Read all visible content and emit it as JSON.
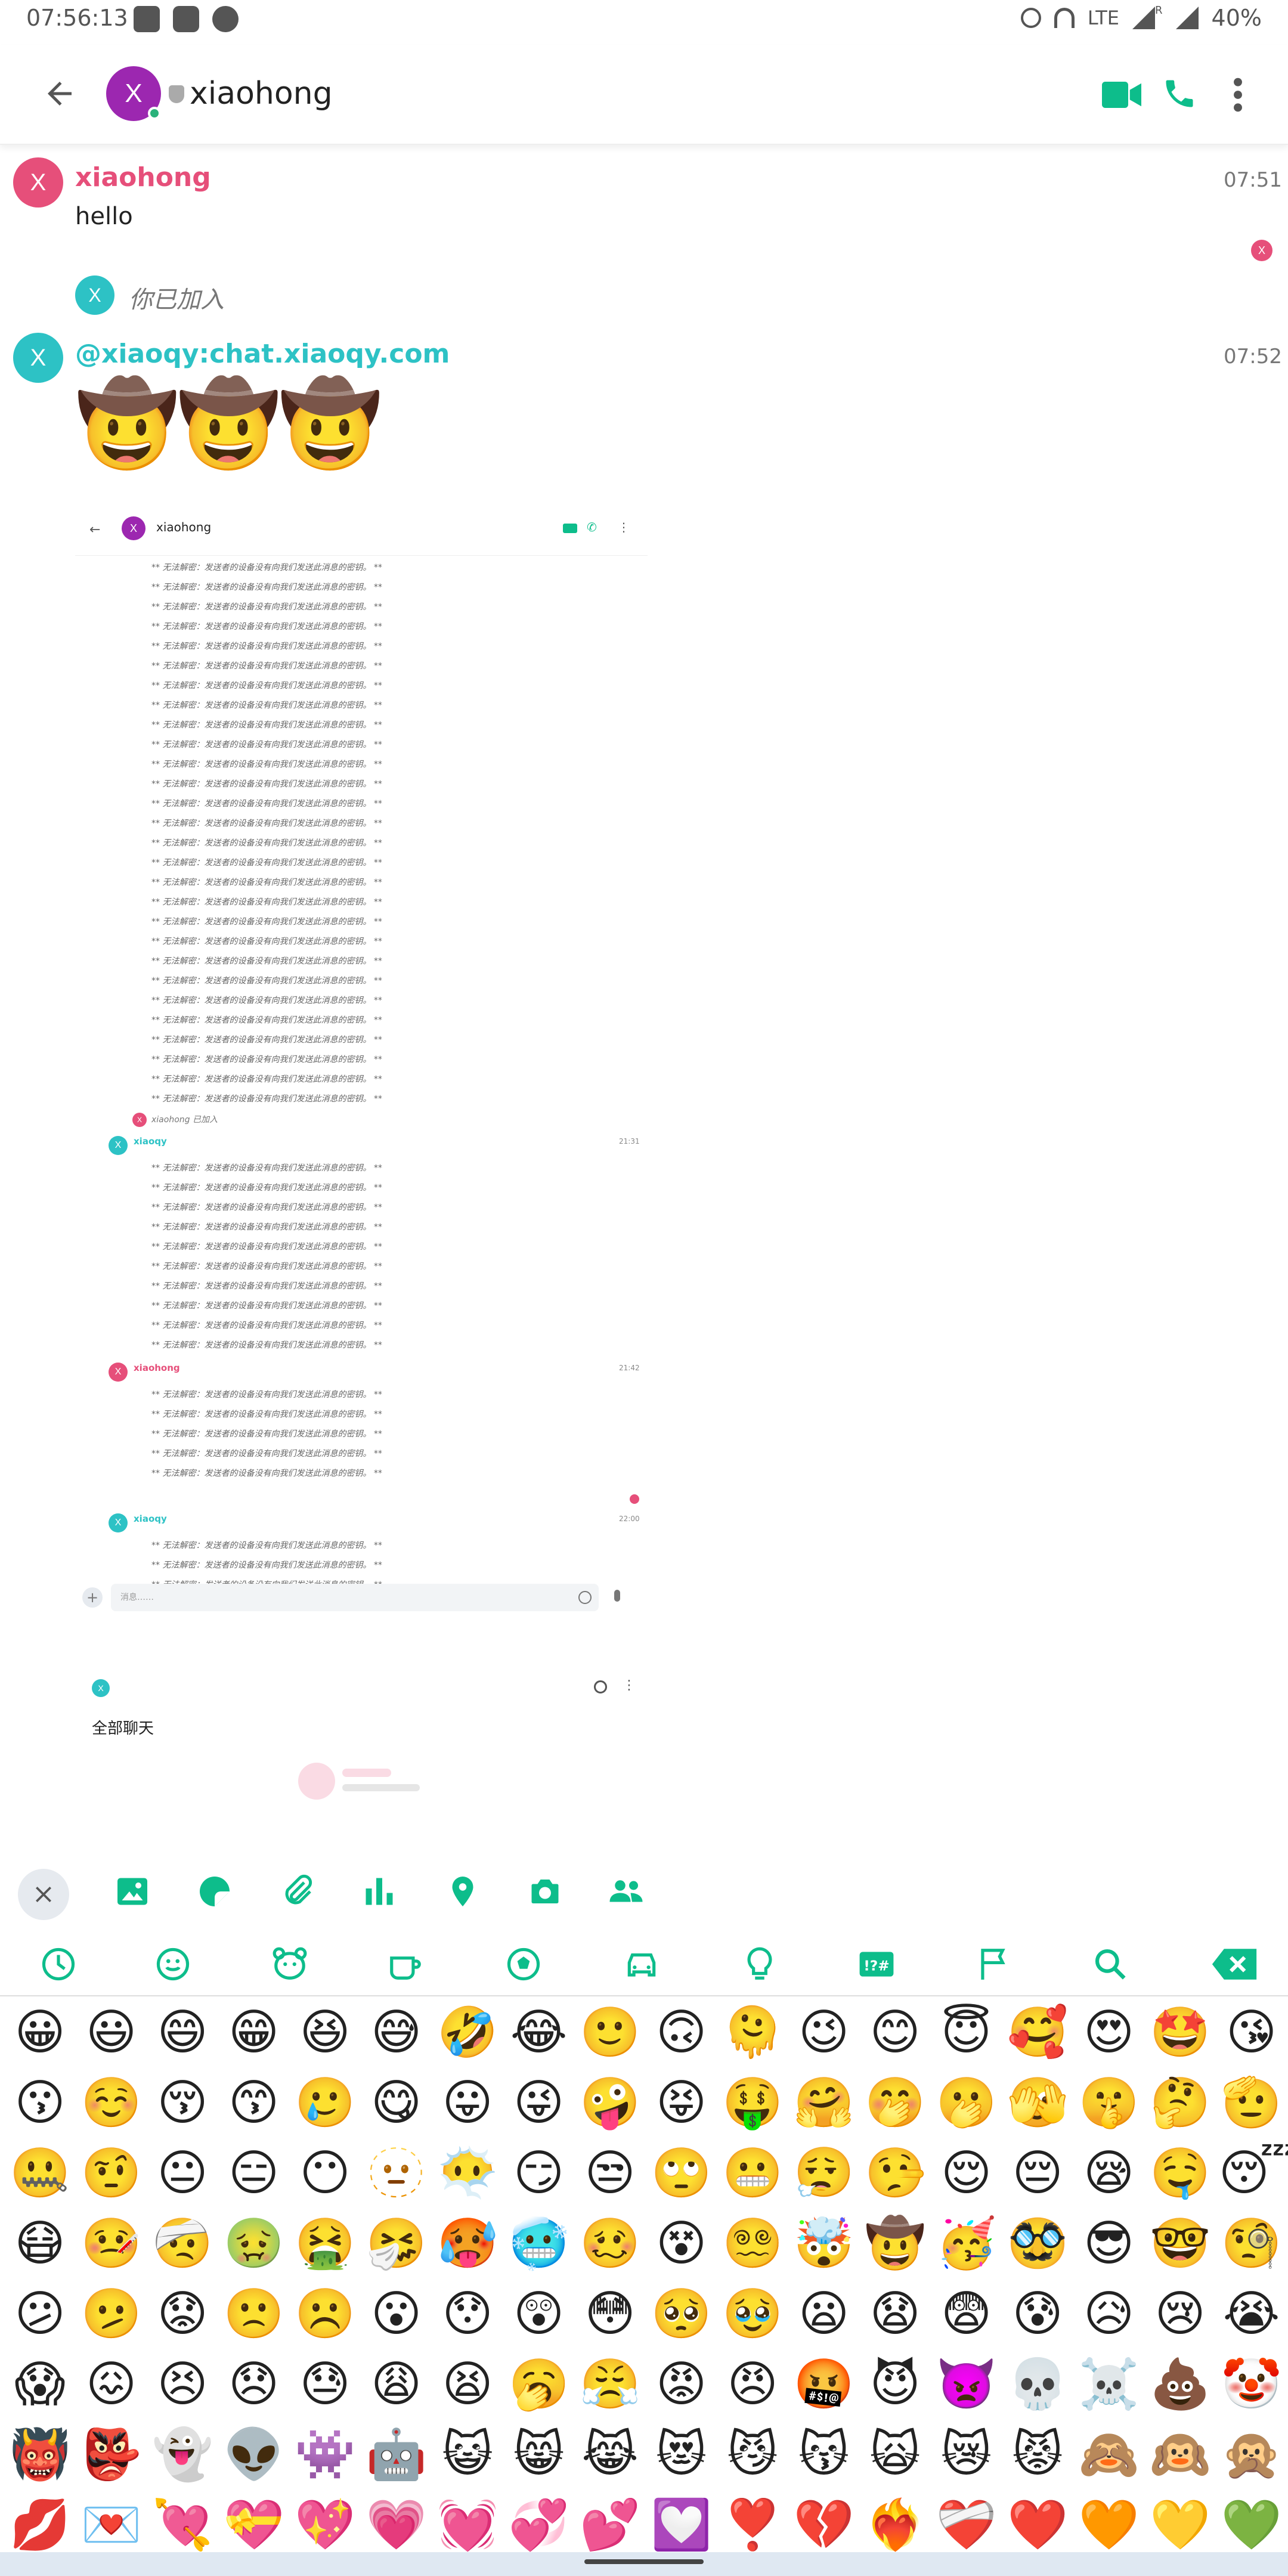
{
  "status_bar": {
    "time": "07:56:13",
    "network": "LTE",
    "roaming": "R",
    "battery": "40%"
  },
  "header": {
    "avatar_letter": "X",
    "title": "xiaohong"
  },
  "messages": [
    {
      "sender": "xiaohong",
      "avatar_letter": "X",
      "time": "07:51",
      "text": "hello",
      "read_letter": "X"
    },
    {
      "event_avatar_letter": "X",
      "event_text": "你已加入"
    },
    {
      "sender": "@xiaoqy:chat.xiaoqy.com",
      "avatar_letter": "X",
      "time": "07:52",
      "emoji": "🤠🤠🤠"
    }
  ],
  "screenshot": {
    "header_title": "xiaohong",
    "avatar_letter": "X",
    "undecryptable_text": "** 无法解密：发送者的设备没有向我们发送此消息的密钥。 **",
    "joined_event": "xiaohong 已加入",
    "group1": {
      "sender": "xiaoqy",
      "time": "21:31"
    },
    "group2": {
      "sender": "xiaohong",
      "time": "21:42"
    },
    "group3": {
      "sender": "xiaoqy",
      "time": "22:00"
    },
    "composer_placeholder": "消息……",
    "all_chats": "全部聊天"
  },
  "attach_bar": {
    "icons": [
      "close-icon",
      "image-icon",
      "sticker-icon",
      "attachment-icon",
      "poll-icon",
      "location-icon",
      "camera-icon",
      "contacts-icon"
    ]
  },
  "emoji_categories": [
    "recent-icon",
    "smileys-icon",
    "animals-icon",
    "food-icon",
    "activities-icon",
    "travel-icon",
    "objects-icon",
    "symbols-icon",
    "flags-icon",
    "search-icon",
    "backspace-icon"
  ],
  "emoji_grid": [
    [
      "😀",
      "😃",
      "😄",
      "😁",
      "😆",
      "😅",
      "🤣",
      "😂",
      "🙂",
      "🙃",
      "🫠",
      "😉",
      "😊",
      "😇",
      "🥰",
      "😍",
      "🤩",
      "😘"
    ],
    [
      "😗",
      "☺️",
      "😚",
      "😙",
      "🥲",
      "😋",
      "😛",
      "😜",
      "🤪",
      "😝",
      "🤑",
      "🤗",
      "🤭",
      "🫢",
      "🫣",
      "🤫",
      "🤔",
      "🫡"
    ],
    [
      "🤐",
      "🤨",
      "😐",
      "😑",
      "😶",
      "🫥",
      "😶‍🌫️",
      "😏",
      "😒",
      "🙄",
      "😬",
      "😮‍💨",
      "🤥",
      "😌",
      "😔",
      "😪",
      "🤤",
      "😴"
    ],
    [
      "😷",
      "🤒",
      "🤕",
      "🤢",
      "🤮",
      "🤧",
      "🥵",
      "🥶",
      "🥴",
      "😵",
      "😵‍💫",
      "🤯",
      "🤠",
      "🥳",
      "🥸",
      "😎",
      "🤓",
      "🧐"
    ],
    [
      "😕",
      "🫤",
      "😟",
      "🙁",
      "☹️",
      "😮",
      "😯",
      "😲",
      "😳",
      "🥺",
      "🥹",
      "😦",
      "😧",
      "😨",
      "😰",
      "😥",
      "😢",
      "😭"
    ],
    [
      "😱",
      "😖",
      "😣",
      "😞",
      "😓",
      "😩",
      "😫",
      "🥱",
      "😤",
      "😡",
      "😠",
      "🤬",
      "😈",
      "👿",
      "💀",
      "☠️",
      "💩",
      "🤡"
    ],
    [
      "👹",
      "👺",
      "👻",
      "👽",
      "👾",
      "🤖",
      "😺",
      "😸",
      "😹",
      "😻",
      "😼",
      "😽",
      "🙀",
      "😿",
      "😾",
      "🙈",
      "🙉",
      "🙊"
    ],
    [
      "💋",
      "💌",
      "💘",
      "💝",
      "💖",
      "💗",
      "💓",
      "💞",
      "💕",
      "💟",
      "❣️",
      "💔",
      "❤️‍🔥",
      "❤️‍🩹",
      "❤️",
      "🧡",
      "💛",
      "💚"
    ]
  ],
  "colors": {
    "accent": "#0dbd8b",
    "xiaohong_name": "#e64f7a",
    "xiaoqy_name": "#2dc2c5",
    "header_avatar": "#9c27b0",
    "avatar_pink": "#e64f7a",
    "avatar_teal": "#2dc2c5"
  }
}
